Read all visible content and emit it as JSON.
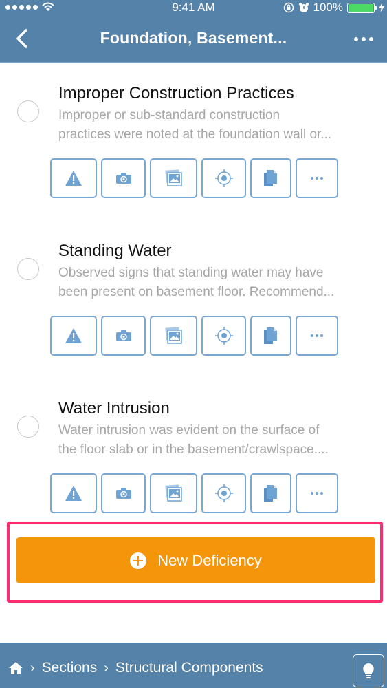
{
  "status_bar": {
    "signal_bars": 5,
    "time": "9:41 AM",
    "battery_percent_label": "100%",
    "battery_level": 1.0,
    "charging": true,
    "colors": {
      "battery_fill": "#4cd964"
    }
  },
  "nav_bar": {
    "back_icon": "chevron-left-icon",
    "title": "Foundation, Basement...",
    "more_icon": "ellipsis-icon",
    "background_color": "#5482a9"
  },
  "items": [
    {
      "title": "Improper Construction Practices",
      "desc_lines": [
        "Improper or sub-standard construction",
        "practices were noted at the foundation wall or..."
      ],
      "selected": false
    },
    {
      "title": "Standing Water",
      "desc_lines": [
        "Observed signs that standing water may have",
        "been present on basement floor. Recommend..."
      ],
      "selected": false
    },
    {
      "title": "Water Intrusion",
      "desc_lines": [
        "Water intrusion was evident on the surface of",
        "the floor slab or in the basement/crawlspace...."
      ],
      "selected": false
    }
  ],
  "item_actions": [
    {
      "icon": "warning-icon"
    },
    {
      "icon": "camera-icon"
    },
    {
      "icon": "photo-gallery-icon"
    },
    {
      "icon": "location-target-icon"
    },
    {
      "icon": "document-icon"
    },
    {
      "icon": "more-icon"
    }
  ],
  "new_button": {
    "label": "New Deficiency",
    "icon": "plus-circle-icon",
    "color": "#f5960a",
    "highlight_color": "#ff2d6f"
  },
  "bottom_bar": {
    "home_icon": "home-icon",
    "breadcrumbs": [
      "Sections",
      "Structural Components"
    ],
    "tip_icon": "lightbulb-icon"
  }
}
